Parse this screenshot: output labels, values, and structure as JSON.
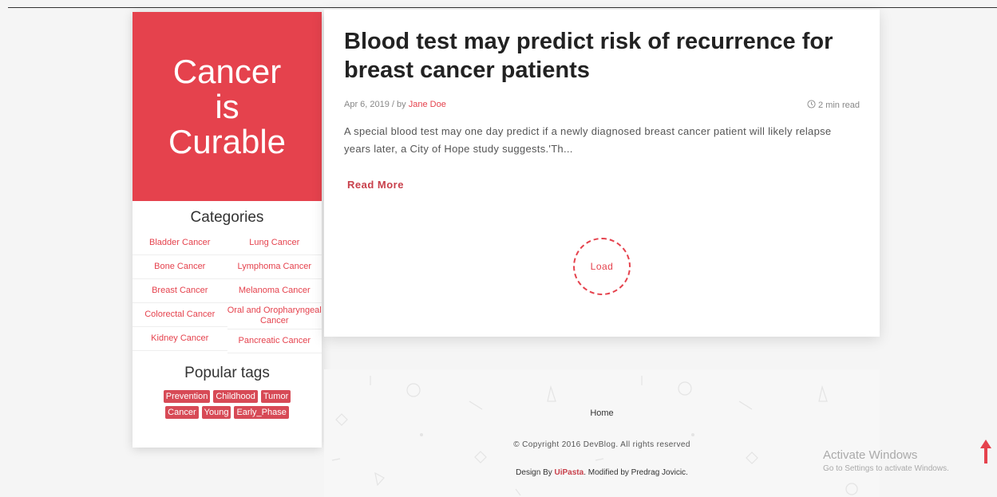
{
  "sidebar": {
    "logo_lines": [
      "Cancer",
      "is",
      "Curable"
    ],
    "categories_title": "Categories",
    "categories_left": [
      "Bladder Cancer",
      "Bone Cancer",
      "Breast Cancer",
      "Colorectal Cancer",
      "Kidney Cancer"
    ],
    "categories_right": [
      "Lung Cancer",
      "Lymphoma Cancer",
      "Melanoma Cancer",
      "Oral and Oropharyngeal Cancer",
      "Pancreatic Cancer"
    ],
    "tags_title": "Popular tags",
    "tags": [
      "Prevention",
      "Childhood",
      "Tumor",
      "Cancer",
      "Young",
      "Early_Phase"
    ]
  },
  "article": {
    "title": "Blood test may predict risk of recurrence for breast cancer patients",
    "date": "Apr 6, 2019",
    "by_sep": " / by ",
    "author": "Jane Doe",
    "read_time": "2 min read",
    "excerpt": "A special blood test may one day predict if a newly diagnosed breast cancer patient will likely relapse years later, a City of Hope study suggests.'Th...",
    "read_more": "Read More",
    "load": "Load"
  },
  "footer": {
    "home": "Home",
    "copyright": "© Copyright 2016 DevBlog. All rights reserved",
    "design_prefix": "Design By ",
    "design_brand": "UiPasta",
    "design_suffix": ". Modified by Predrag Jovicic."
  },
  "overlay": {
    "activate_title": "Activate Windows",
    "activate_sub": "Go to Settings to activate Windows."
  },
  "colors": {
    "accent": "#e5424d",
    "tag_bg": "#d74a56"
  }
}
